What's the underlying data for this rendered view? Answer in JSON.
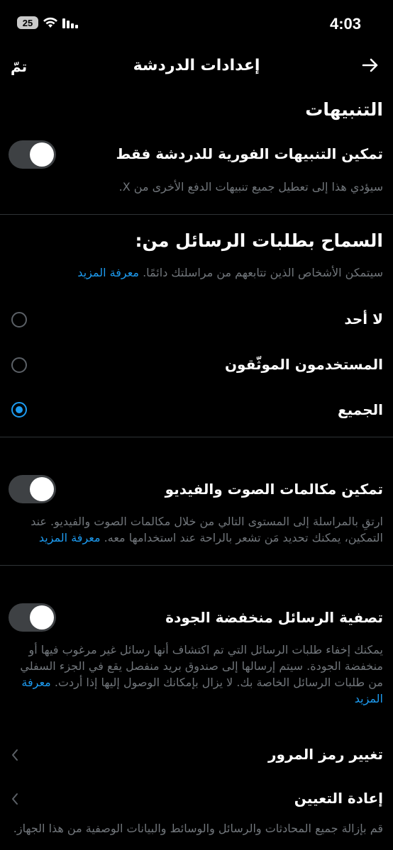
{
  "status_bar": {
    "time": "4:03",
    "battery": "25"
  },
  "header": {
    "title": "إعدادات الدردشة",
    "done": "تمّ"
  },
  "notifications": {
    "title": "التنبيهات",
    "push_toggle_label": "تمكين التنبيهات الفورية للدردشة فقط",
    "push_toggle_desc": "سيؤدي هذا إلى تعطيل جميع تنبيهات الدفع الأخرى من X."
  },
  "message_requests": {
    "title": "السماح بطلبات الرسائل من:",
    "desc": "سيتمكن الأشخاص الذين تتابعهم من مراسلتك دائمًا.",
    "learn_more": "معرفة المزيد",
    "options": [
      {
        "label": "لا أحد",
        "selected": false
      },
      {
        "label": "المستخدمون الموثّقون",
        "selected": false
      },
      {
        "label": "الجميع",
        "selected": true
      }
    ]
  },
  "calls": {
    "label": "تمكين مكالمات الصوت والفيديو",
    "desc": "ارتقِ بالمراسلة إلى المستوى التالي من خلال مكالمات الصوت والفيديو. عند التمكين، يمكنك تحديد مَن تشعر بالراحة عند استخدامها معه.",
    "learn_more": "معرفة المزيد"
  },
  "filter": {
    "label": "تصفية الرسائل منخفضة الجودة",
    "desc": "يمكنك إخفاء طلبات الرسائل التي تم اكتشاف أنها رسائل غير مرغوب فيها أو منخفضة الجودة. سيتم إرسالها إلى صندوق بريد منفصل يقع في الجزء السفلي من طلبات الرسائل الخاصة بك. لا يزال بإمكانك الوصول إليها إذا أردت.",
    "learn_more": "معرفة المزيد"
  },
  "change_passcode": {
    "label": "تغيير رمز المرور"
  },
  "reset": {
    "label": "إعادة التعيين",
    "desc": "قم بإزالة جميع المحادثات والرسائل والوسائط والبيانات الوصفية من هذا الجهاز."
  },
  "colors": {
    "accent": "#1d9bf0",
    "background": "#000000",
    "muted": "#71767b"
  }
}
